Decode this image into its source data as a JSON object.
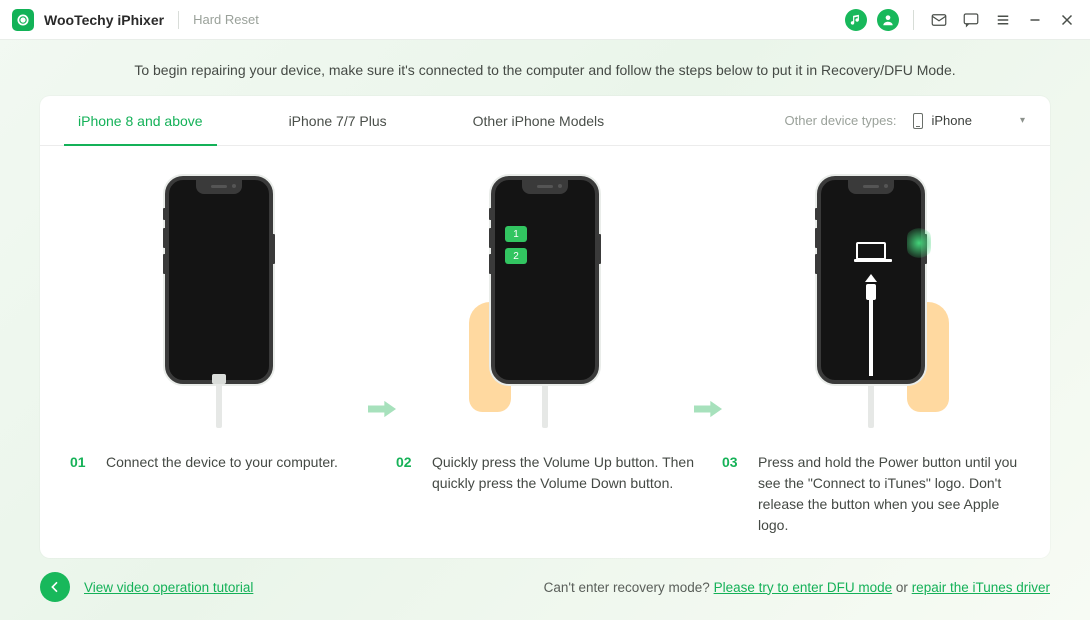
{
  "titlebar": {
    "app_name": "WooTechy iPhixer",
    "section": "Hard Reset"
  },
  "instruction": "To begin repairing your device, make sure it's connected to the computer and follow the steps below to put it in Recovery/DFU Mode.",
  "tabs": {
    "items": [
      "iPhone 8 and above",
      "iPhone 7/7 Plus",
      "Other iPhone Models"
    ],
    "active_index": 0,
    "device_type_label": "Other device types:",
    "device_type_value": "iPhone"
  },
  "steps": [
    {
      "num": "01",
      "text": "Connect the device to your computer."
    },
    {
      "num": "02",
      "text": "Quickly press the Volume Up button. Then quickly press the Volume Down button."
    },
    {
      "num": "03",
      "text": "Press and hold the Power button until you see the \"Connect to iTunes\" logo. Don't release the button when you see Apple logo."
    }
  ],
  "footer": {
    "tutorial_link": "View video operation tutorial",
    "help_prefix": "Can't enter recovery mode? ",
    "dfu_link": "Please try to enter DFU mode",
    "or": " or ",
    "driver_link": "repair the iTunes driver"
  }
}
